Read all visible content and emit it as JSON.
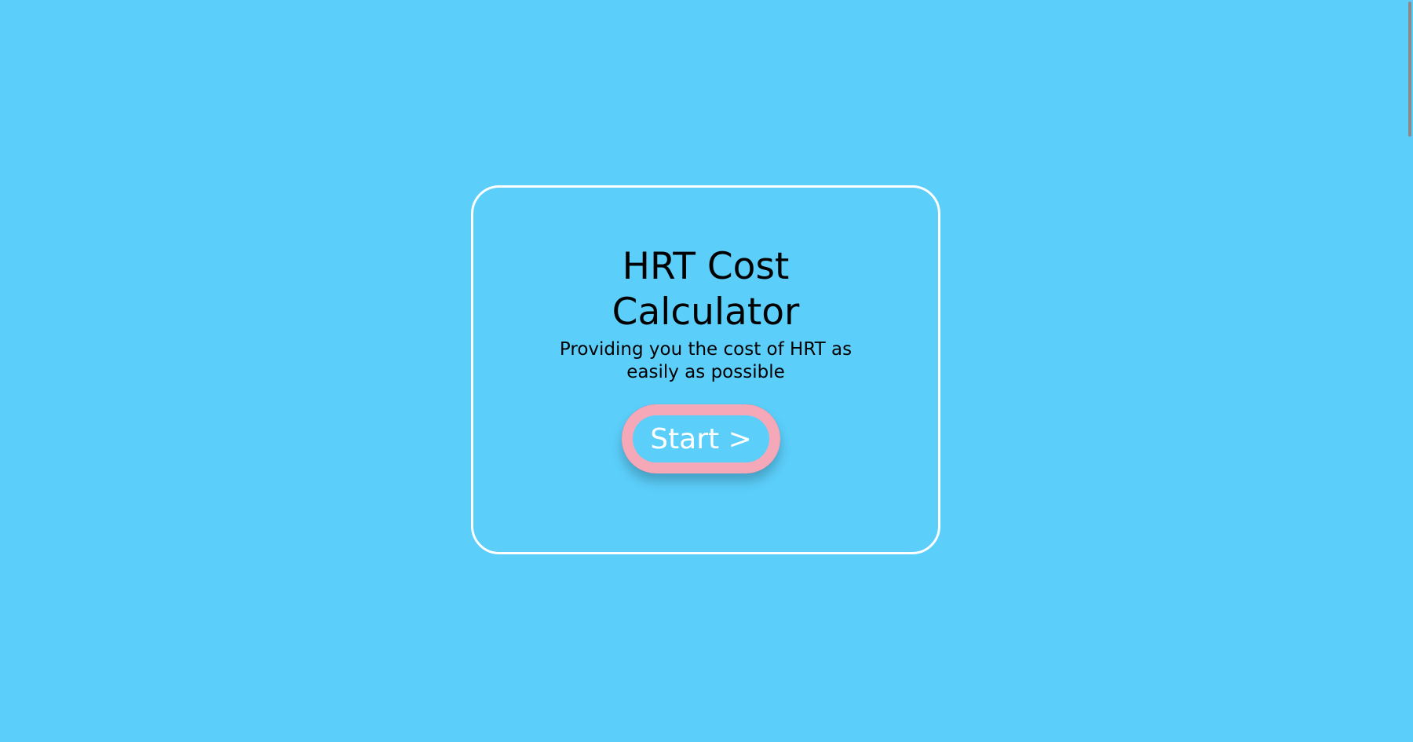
{
  "page": {
    "background_color": "#5bcefa"
  },
  "card": {
    "border_color": "#ffffff",
    "title": "HRT Cost Calculator",
    "subtitle": "Providing you the cost of HRT as easily as possible"
  },
  "start_button": {
    "label": "Start >",
    "ring_color": "#f5a9b8",
    "base_color": "#c8304f",
    "fill_color": "#5bcefa"
  }
}
